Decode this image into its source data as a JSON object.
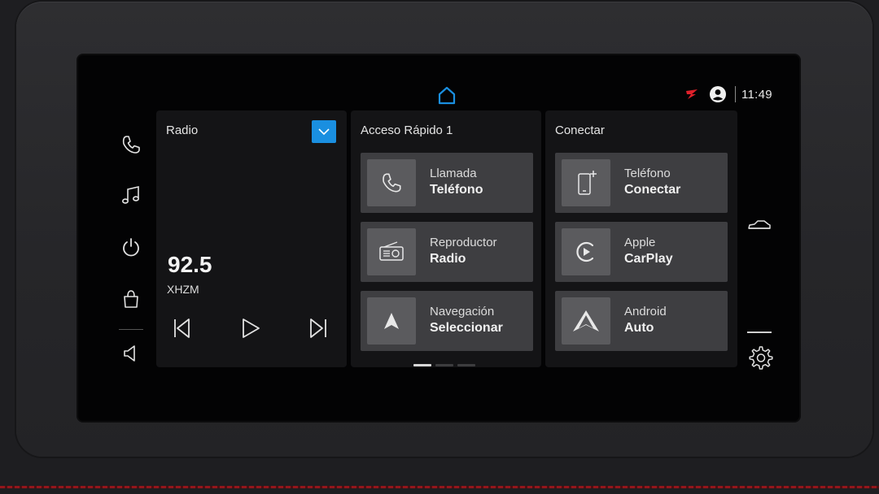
{
  "statusbar": {
    "time": "11:49"
  },
  "rail": {
    "items": [
      {
        "icon": "phone-icon"
      },
      {
        "icon": "music-icon"
      },
      {
        "icon": "power-icon"
      },
      {
        "icon": "bag-icon"
      },
      {
        "icon": "volume-icon"
      }
    ]
  },
  "radio": {
    "title": "Radio",
    "frequency": "92.5",
    "station": "XHZM"
  },
  "quick_access": {
    "title": "Acceso Rápido 1",
    "tiles": [
      {
        "line1": "Llamada",
        "line2": "Teléfono",
        "icon": "phone-icon"
      },
      {
        "line1": "Reproductor",
        "line2": "Radio",
        "icon": "radio-icon"
      },
      {
        "line1": "Navegación",
        "line2": "Seleccionar",
        "icon": "navigation-arrow-icon"
      }
    ],
    "page_indicator": {
      "pages": 3,
      "current": 1
    }
  },
  "connect": {
    "title": "Conectar",
    "tiles": [
      {
        "line1": "Teléfono",
        "line2": "Conectar",
        "icon": "phone-add-icon"
      },
      {
        "line1": "Apple",
        "line2": "CarPlay",
        "icon": "carplay-icon"
      },
      {
        "line1": "Android",
        "line2": "Auto",
        "icon": "android-auto-icon"
      }
    ]
  },
  "colors": {
    "accent": "#1a8fe0",
    "indicator": "#e0202a",
    "tile": "#3e3e41",
    "tile_icon": "#5b5b5e"
  }
}
